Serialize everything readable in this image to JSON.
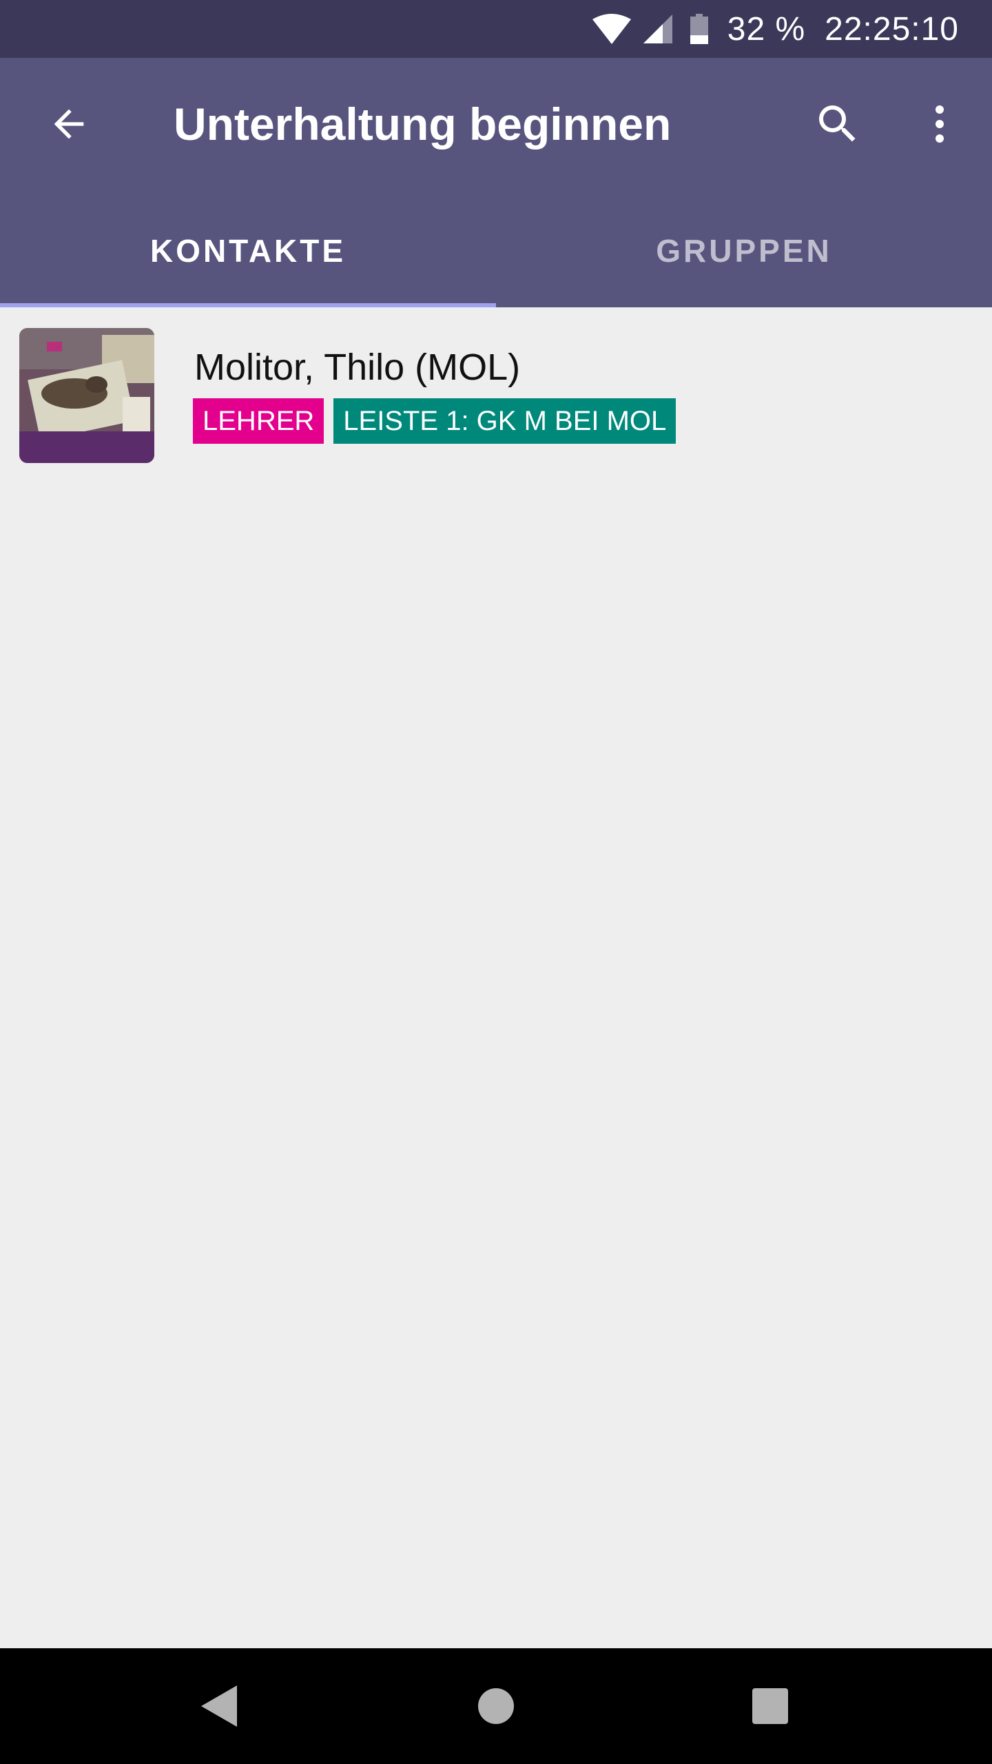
{
  "status_bar": {
    "battery": "32 %",
    "time": "22:25:10",
    "icons": [
      "wifi-icon",
      "cell-signal-icon",
      "battery-icon"
    ]
  },
  "header": {
    "title": "Unterhaltung beginnen",
    "icons": [
      "back-arrow-icon",
      "search-icon",
      "more-vert-icon"
    ]
  },
  "tabs": [
    {
      "label": "KONTAKTE",
      "active": true
    },
    {
      "label": "GRUPPEN",
      "active": false
    }
  ],
  "contacts": [
    {
      "name": "Molitor, Thilo (MOL)",
      "badges": [
        {
          "label": "LEHRER",
          "color": "#e3008c"
        },
        {
          "label": "LEISTE 1: GK M BEI MOL",
          "color": "#00897b"
        }
      ]
    }
  ],
  "nav_bar": {
    "icons": [
      "nav-back-icon",
      "nav-home-icon",
      "nav-recents-icon"
    ]
  },
  "colors": {
    "status_bar": "#3b3859",
    "app_bar": "#57557e",
    "tab_indicator": "#9fa0ef",
    "background": "#eeeeee"
  }
}
